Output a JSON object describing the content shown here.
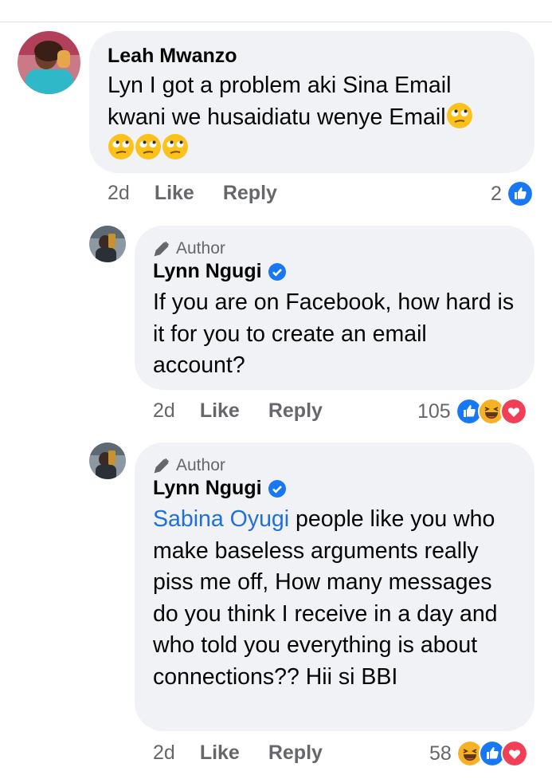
{
  "comments": [
    {
      "name": "Leah Mwanzo",
      "text": "Lyn I got a problem aki Sina Email kwani we husaidiatu wenye Email",
      "emoji": "eye-roll-emoji",
      "emoji_count": 4,
      "time": "2d",
      "like_label": "Like",
      "reply_label": "Reply",
      "reaction_count": "2",
      "reactions": [
        "like"
      ]
    }
  ],
  "replies": [
    {
      "author_badge": "Author",
      "name": "Lynn Ngugi",
      "verified": true,
      "text": "If you are on Facebook, how hard is it for you to create an email account?",
      "time": "2d",
      "like_label": "Like",
      "reply_label": "Reply",
      "reaction_count": "105",
      "reactions": [
        "like",
        "haha",
        "love"
      ]
    },
    {
      "author_badge": "Author",
      "name": "Lynn Ngugi",
      "verified": true,
      "mention": "Sabina Oyugi",
      "text": "people like you who make baseless arguments really piss me off, How many messages do you think I receive in a day and who told you everything is about connections?? Hii si BBI",
      "time": "2d",
      "like_label": "Like",
      "reply_label": "Reply",
      "reaction_count": "58",
      "reactions": [
        "haha",
        "like",
        "love"
      ]
    }
  ],
  "colors": {
    "bubble": "#f0f2f5",
    "meta": "#65676b",
    "mention": "#216fdb",
    "like": "#1877f2",
    "love": "#f33e58",
    "haha": "#f7b125"
  }
}
